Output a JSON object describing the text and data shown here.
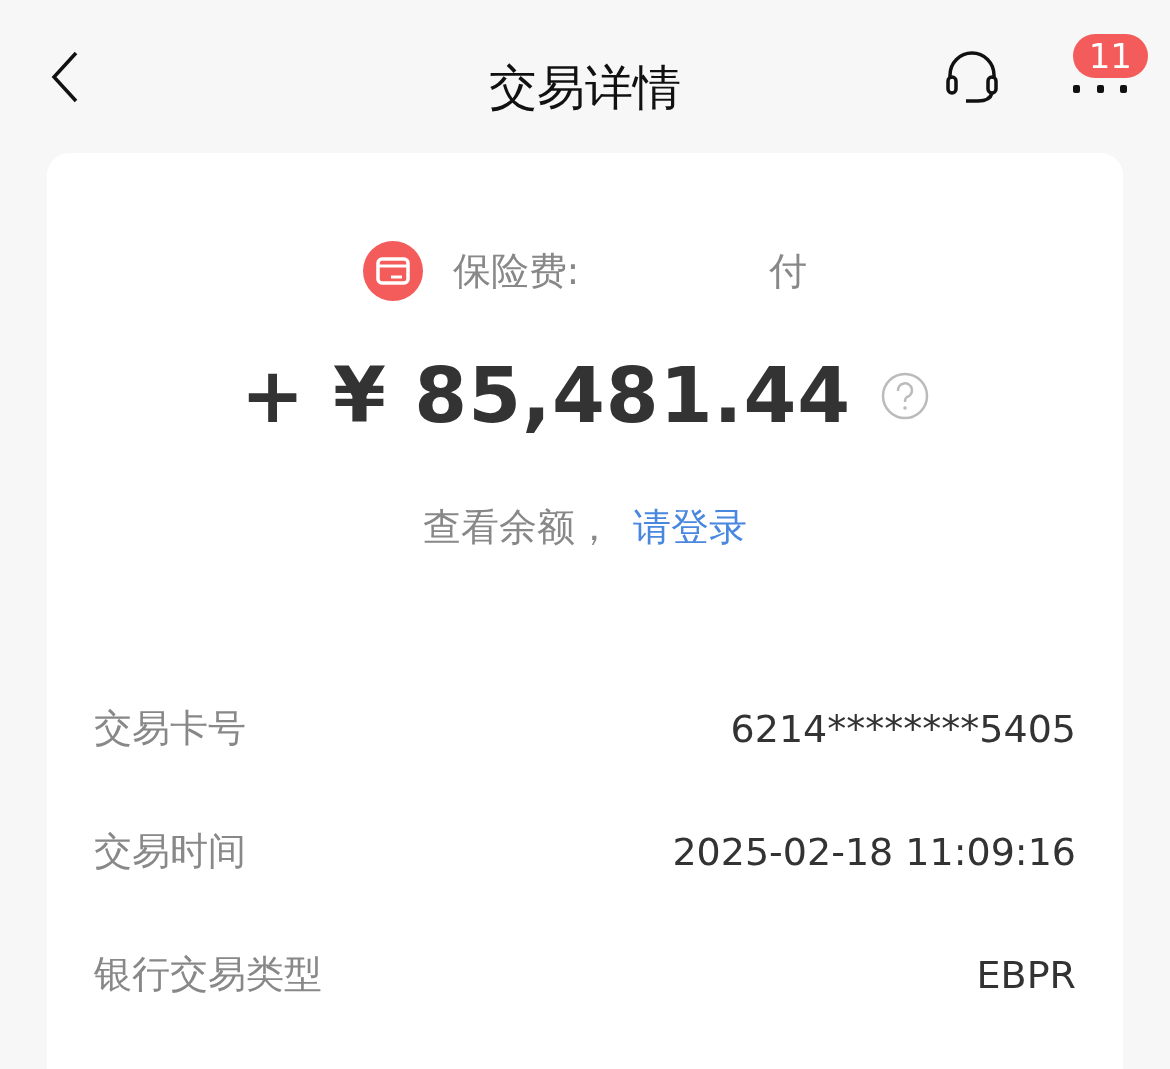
{
  "header": {
    "title": "交易详情",
    "badge": "11"
  },
  "summary": {
    "category": "保险费:",
    "category_tail": "付",
    "amount": "+ ¥ 85,481.44",
    "balance_prompt": "查看余额，",
    "login_link": "请登录"
  },
  "details": [
    {
      "label": "交易卡号",
      "value": "6214********5405"
    },
    {
      "label": "交易时间",
      "value": "2025-02-18 11:09:16"
    },
    {
      "label": "银行交易类型",
      "value": "EBPR"
    }
  ]
}
